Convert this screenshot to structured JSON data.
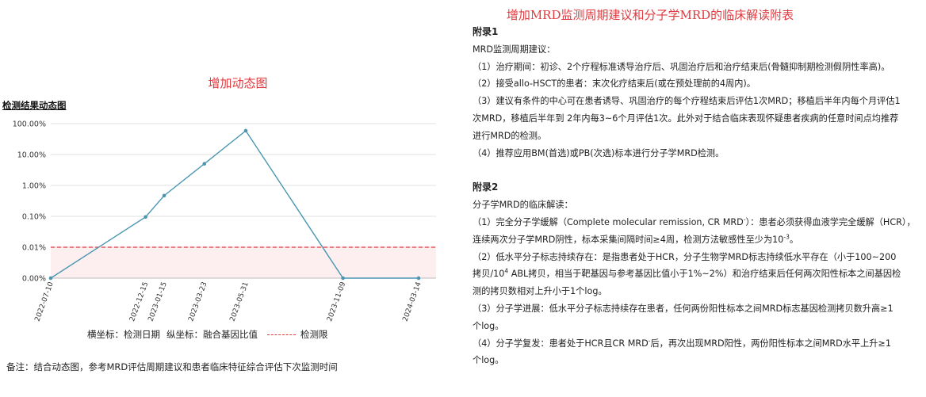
{
  "left": {
    "title": "增加动态图",
    "chart_heading": "检测结果动态图",
    "legend": {
      "x_label": "横坐标：检测日期",
      "y_label": "纵坐标：融合基因比值",
      "limit_label": "检测限"
    },
    "note": "备注：结合动态图，参考MRD评估周期建议和患者临床特征综合评估下次监测时间"
  },
  "chart_data": {
    "type": "line",
    "title": "",
    "xlabel": "检测日期",
    "ylabel": "融合基因比值",
    "y_scale": "log",
    "y_ticks": [
      {
        "label": "0.00%",
        "level": 0
      },
      {
        "label": "0.01%",
        "level": 1
      },
      {
        "label": "0.10%",
        "level": 2
      },
      {
        "label": "1.00%",
        "level": 3
      },
      {
        "label": "10.00%",
        "level": 4
      },
      {
        "label": "100.00%",
        "level": 5
      }
    ],
    "x_range": [
      "2022-07-10",
      "2024-03-14"
    ],
    "points": [
      {
        "date": "2022-07-10",
        "value_level": 0
      },
      {
        "date": "2022-12-15",
        "value_level": 1.98
      },
      {
        "date": "2023-01-15",
        "value_level": 2.67
      },
      {
        "date": "2023-03-23",
        "value_level": 3.7
      },
      {
        "date": "2023-05-31",
        "value_level": 4.77
      },
      {
        "date": "2023-11-09",
        "value_level": 0
      },
      {
        "date": "2024-03-14",
        "value_level": 0
      }
    ],
    "detection_limit_level": 1,
    "series_color": "#4a96b1",
    "limit_color": "#e0393e",
    "grid": true
  },
  "right": {
    "title": "增加MRD监测周期建议和分子学MRD的临床解读附表",
    "appendix1": {
      "heading": "附录1",
      "lines": [
        "MRD监测周期建议：",
        "（1）治疗期间：初诊、2个疗程标准诱导治疗后、巩固治疗后和治疗结束后(骨髓抑制期检测假阴性率高)。",
        "（2）接受allo-HSCT的患者：末次化疗结束后(或在预处理前的4周内)。",
        "（3）建议有条件的中心可在患者诱导、巩固治疗的每个疗程结束后评估1次MRD；移植后半年内每个月评估1",
        "次MRD，移植后半年到 2年内每3~6个月评估1次。此外对于结合临床表现怀疑患者疾病的任意时间点均推荐",
        "进行MRD的检测。",
        "（4）推荐应用BM(首选)或PB(次选)标本进行分子学MRD检测。"
      ]
    },
    "appendix2": {
      "heading": "附录2",
      "intro": "分子学MRD的临床解读：",
      "l1a": "（1）完全分子学缓解（Complete molecular remission, CR MRD",
      "l1sup": "-",
      "l1b": "）：患者必须获得血液学完全缓解（HCR），",
      "l2a": "连续两次分子学MRD阴性，标本采集间隔时间≥4周，检测方法敏感性至少为10",
      "l2sup": "-3",
      "l2b": "。",
      "l3": "（2）低水平分子标志持续存在：是指患者处于HCR，分子生物学MRD标志持续低水平存在（小于100~200",
      "l4a": "拷贝/10",
      "l4sup": "4",
      "l4b": " ABL拷贝，相当于靶基因与参考基因比值小于1%~2%）和治疗结束后任何两次阳性标本之间基因检",
      "l5": "测的拷贝数相对上升小于1个log。",
      "l6": "（3）分子学进展：低水平分子标志持续存在患者，任何两份阳性标本之间MRD标志基因检测拷贝数升高≥1",
      "l7": "个log。",
      "l8a": "（4）分子学复发：患者处于HCR且CR MRD",
      "l8sup": "-",
      "l8b": "后，再次出现MRD阳性，两份阳性标本之间MRD水平上升≥1",
      "l9": "个log。"
    }
  }
}
